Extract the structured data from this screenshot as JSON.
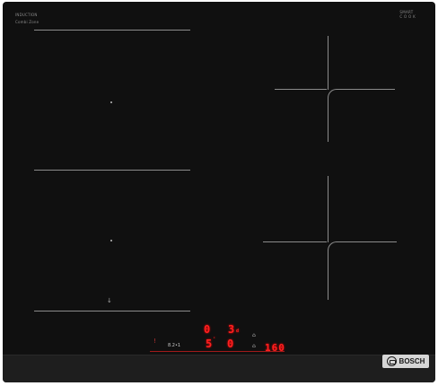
{
  "branding": {
    "left_title": "INDUCTION",
    "left_sub": "Combi Zone",
    "right_title": "SMART",
    "right_sub": "C O O K",
    "logo_text": "BOSCH"
  },
  "displays": {
    "zone_a_level": "0",
    "zone_b_level": "3",
    "zone_b_suffix": "d",
    "zone_c_level": "5",
    "zone_c_mark": "ˈ",
    "zone_d_level": "0",
    "timer_value": "160",
    "left_small": "8.2•1"
  },
  "labels": {
    "left_flag": "!",
    "left_icon": "↓",
    "mid_icon_top": "⌂",
    "mid_icon_bottom": "⌂"
  },
  "scale": {
    "values": [
      "0",
      "1",
      "2",
      "3",
      "4",
      "5",
      "6",
      "7",
      "8",
      "9"
    ]
  },
  "colors": {
    "surface": "#101010",
    "frame": "#1e1e1e",
    "display": "#ff2020",
    "logo_plate": "#d6d6d6"
  },
  "icons": {
    "power": "power-icon",
    "hand": "hand-icon",
    "lock": "lock-icon",
    "logo": "bosch-logo-icon"
  }
}
